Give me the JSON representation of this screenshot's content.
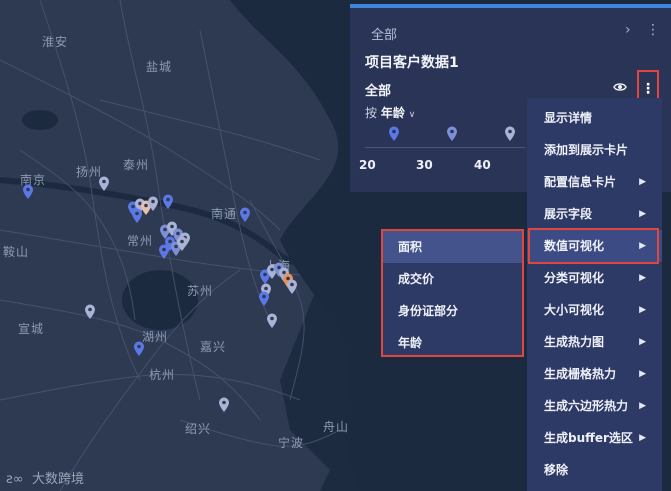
{
  "map": {
    "cities": [
      "淮安",
      "盐城",
      "扬州",
      "泰州",
      "南京",
      "常州",
      "南通",
      "鞍山",
      "苏州",
      "上海",
      "宣城",
      "湖州",
      "嘉兴",
      "杭州",
      "绍兴",
      "宁波",
      "舟山"
    ],
    "logo_text": "大数跨境"
  },
  "panel": {
    "top_label": "全部",
    "chevron": "›",
    "dots": "⋮",
    "project_title": "项目客户数据1",
    "layer_label": "全部",
    "group_prefix": "按",
    "group_field": "年龄",
    "axis_ticks": [
      "20",
      "30",
      "40"
    ],
    "more_dots": "⋮"
  },
  "menu": {
    "items": [
      {
        "label": "显示详情",
        "has_sub": false
      },
      {
        "label": "添加到展示卡片",
        "has_sub": false
      },
      {
        "label": "配置信息卡片",
        "has_sub": true
      },
      {
        "label": "展示字段",
        "has_sub": true
      },
      {
        "label": "数值可视化",
        "has_sub": true
      },
      {
        "label": "分类可视化",
        "has_sub": true
      },
      {
        "label": "大小可视化",
        "has_sub": true
      },
      {
        "label": "生成热力图",
        "has_sub": true
      },
      {
        "label": "生成栅格热力",
        "has_sub": true
      },
      {
        "label": "生成六边形热力",
        "has_sub": true
      },
      {
        "label": "生成buffer选区",
        "has_sub": true
      },
      {
        "label": "移除",
        "has_sub": false
      }
    ],
    "arrow": "▶"
  },
  "submenu": {
    "items": [
      "面积",
      "成交价",
      "身份证部分",
      "年龄"
    ]
  },
  "colors": {
    "marker_blue": "#5b78e6",
    "marker_light": "#aab3d6",
    "marker_orange": "#e8925a",
    "highlight_red": "#e0463e",
    "panel_bg": "#2a3457",
    "menu_bg": "#2e3a66"
  }
}
